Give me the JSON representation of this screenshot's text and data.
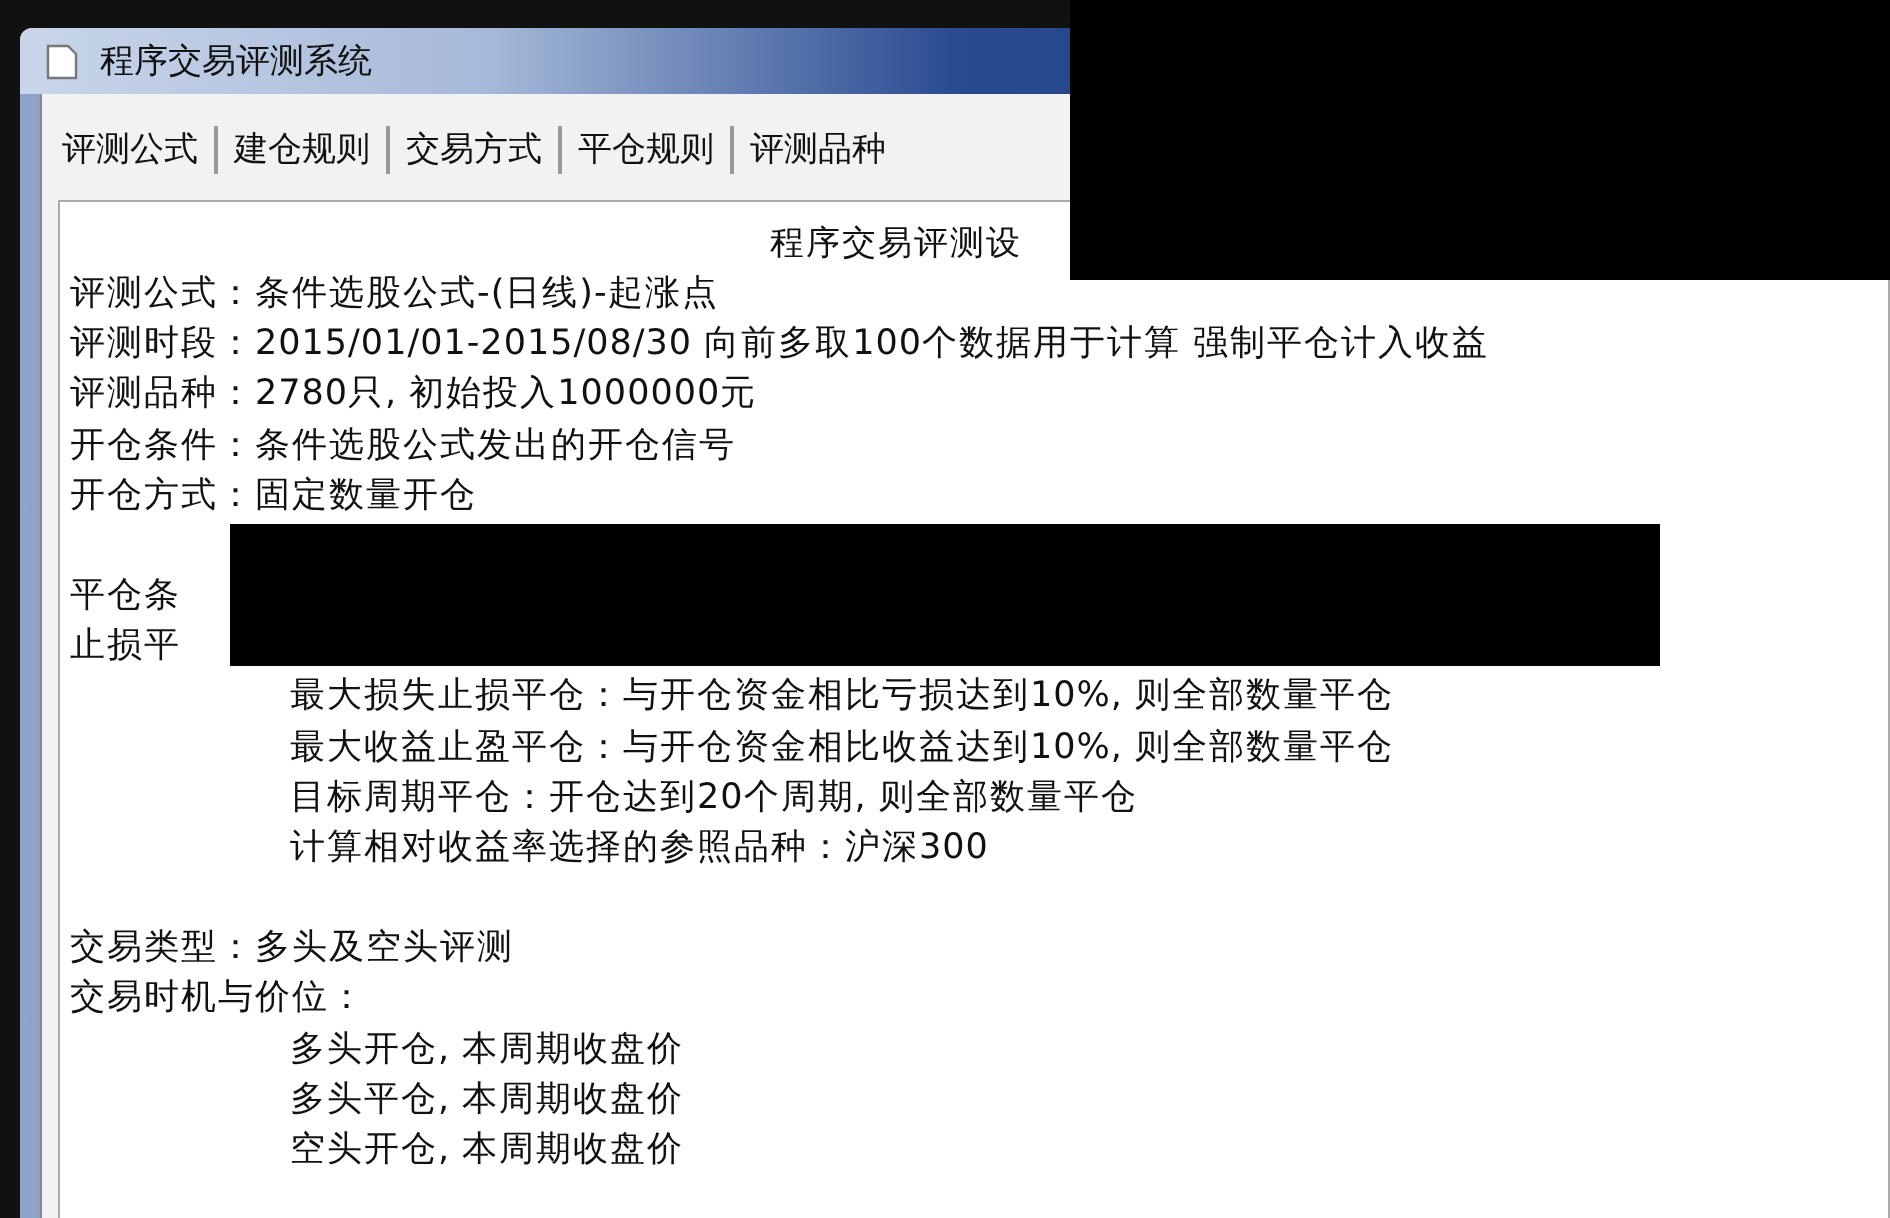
{
  "window": {
    "title": "程序交易评测系统"
  },
  "tabs": [
    {
      "label": "评测公式"
    },
    {
      "label": "建仓规则"
    },
    {
      "label": "交易方式"
    },
    {
      "label": "平仓规则"
    },
    {
      "label": "评测品种"
    }
  ],
  "report": {
    "heading": "程序交易评测设",
    "lines": [
      {
        "kind": "line",
        "text": "评测公式：条件选股公式-(日线)-起涨点"
      },
      {
        "kind": "line",
        "text": "评测时段：2015/01/01-2015/08/30 向前多取100个数据用于计算 强制平仓计入收益"
      },
      {
        "kind": "line",
        "text": "评测品种：2780只, 初始投入1000000元"
      },
      {
        "kind": "line",
        "text": "开仓条件：条件选股公式发出的开仓信号"
      },
      {
        "kind": "line",
        "text": "开仓方式：固定数量开仓"
      },
      {
        "kind": "blank"
      },
      {
        "kind": "line",
        "text": "平仓条"
      },
      {
        "kind": "line",
        "text": "止损平"
      },
      {
        "kind": "sub",
        "text": "最大损失止损平仓：与开仓资金相比亏损达到10%, 则全部数量平仓"
      },
      {
        "kind": "sub",
        "text": "最大收益止盈平仓：与开仓资金相比收益达到10%, 则全部数量平仓"
      },
      {
        "kind": "sub",
        "text": "目标周期平仓：开仓达到20个周期, 则全部数量平仓"
      },
      {
        "kind": "sub",
        "text": "计算相对收益率选择的参照品种：沪深300"
      },
      {
        "kind": "blank"
      },
      {
        "kind": "line",
        "text": "交易类型：多头及空头评测"
      },
      {
        "kind": "line",
        "text": "交易时机与价位："
      },
      {
        "kind": "sub",
        "text": "多头开仓, 本周期收盘价"
      },
      {
        "kind": "sub",
        "text": "多头平仓, 本周期收盘价"
      },
      {
        "kind": "sub",
        "text": "空头开仓, 本周期收盘价"
      }
    ]
  }
}
